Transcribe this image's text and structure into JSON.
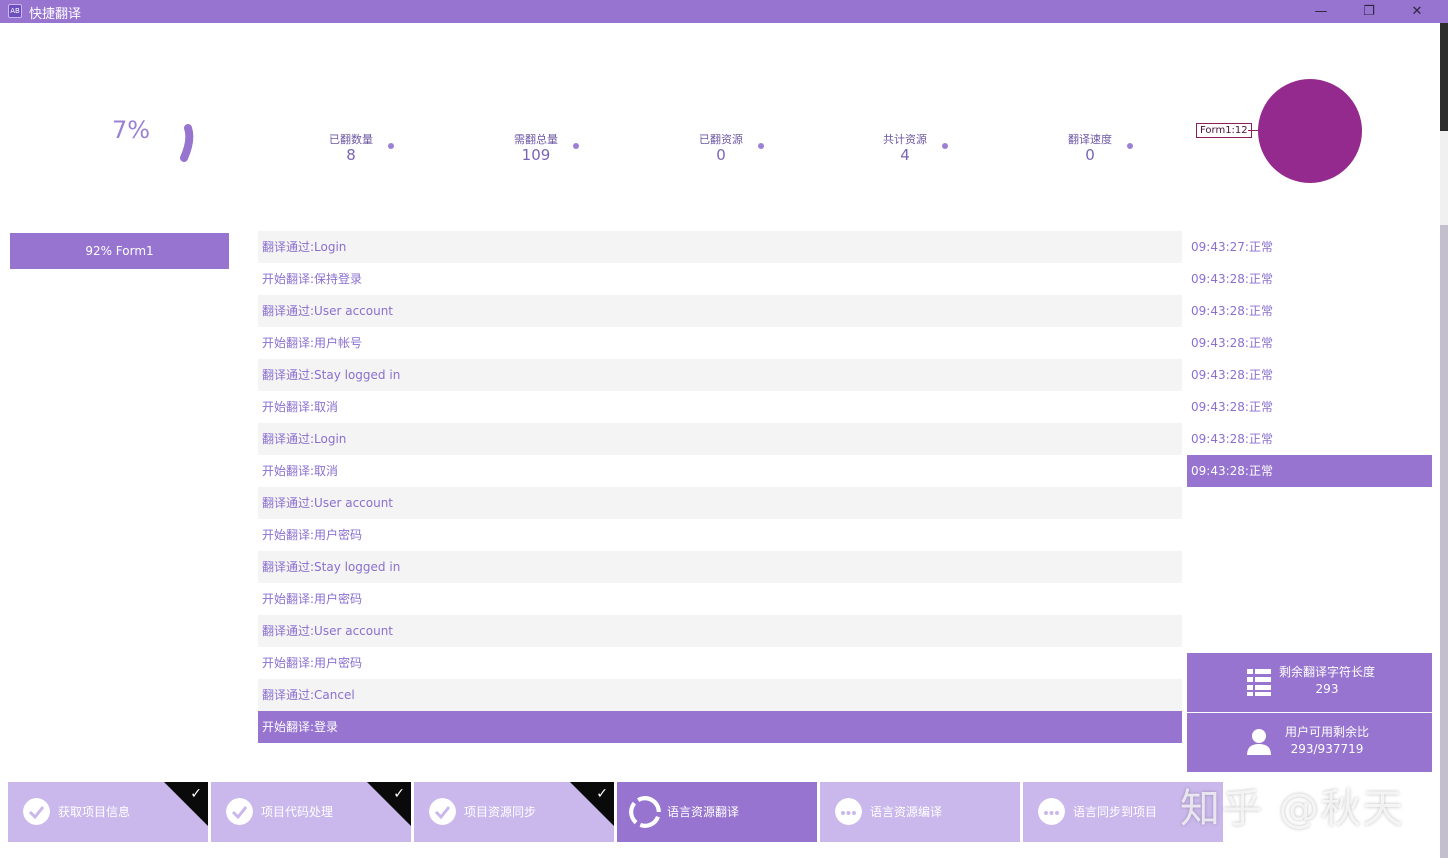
{
  "window": {
    "title": "快捷翻译",
    "icon_label": "AB",
    "minimize": "—",
    "restore": "❐",
    "close": "✕"
  },
  "progress_ring": {
    "percent_label": "7%",
    "value": 0.07
  },
  "stats": [
    {
      "label": "已翻数量",
      "value": "8"
    },
    {
      "label": "需翻总量",
      "value": "109"
    },
    {
      "label": "已翻资源",
      "value": "0"
    },
    {
      "label": "共计资源",
      "value": "4"
    },
    {
      "label": "翻译速度",
      "value": "0"
    }
  ],
  "form_tag": "Form1:12",
  "circle_color": "#942a8e",
  "progress_box": "92% Form1",
  "log": [
    "翻译通过:Login",
    "开始翻译:保持登录",
    "翻译通过:User account",
    "开始翻译:用户帐号",
    "翻译通过:Stay logged in",
    "开始翻译:取消",
    "翻译通过:Login",
    "开始翻译:取消",
    "翻译通过:User account",
    "开始翻译:用户密码",
    "翻译通过:Stay logged in",
    "开始翻译:用户密码",
    "翻译通过:User account",
    "开始翻译:用户密码",
    "翻译通过:Cancel",
    "开始翻译:登录"
  ],
  "times": [
    "09:43:27:正常",
    "09:43:28:正常",
    "09:43:28:正常",
    "09:43:28:正常",
    "09:43:28:正常",
    "09:43:28:正常",
    "09:43:28:正常",
    "09:43:28:正常"
  ],
  "info_cards": [
    {
      "title": "剩余翻译字符长度",
      "value": "293",
      "icon": "list-icon"
    },
    {
      "title": "用户可用剩余比",
      "value": "293/937719",
      "icon": "user-icon"
    }
  ],
  "steps": [
    {
      "label": "获取项目信息",
      "state": "done",
      "icon": "check-circle-icon"
    },
    {
      "label": "项目代码处理",
      "state": "done",
      "icon": "check-circle-icon"
    },
    {
      "label": "项目资源同步",
      "state": "done",
      "icon": "check-circle-icon"
    },
    {
      "label": "语言资源翻译",
      "state": "active",
      "icon": "spinner-icon"
    },
    {
      "label": "语言资源编译",
      "state": "pending",
      "icon": "more-icon"
    },
    {
      "label": "语言同步到项目",
      "state": "pending",
      "icon": "more-icon"
    }
  ],
  "watermark": "知乎 @秋天",
  "colors": {
    "accent": "#9674cf",
    "accent_light": "#cab8ec",
    "circle": "#942a8e"
  }
}
